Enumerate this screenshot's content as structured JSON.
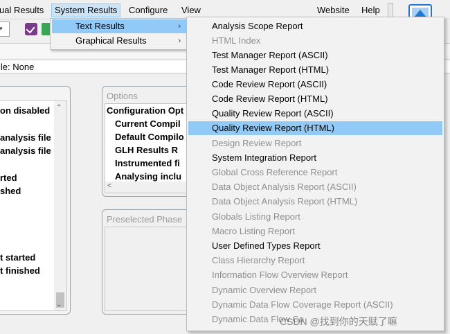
{
  "menubar": {
    "items": [
      "ual Results",
      "System Results",
      "Configure",
      "View",
      "Website",
      "Help"
    ]
  },
  "file_row": {
    "label": "ile: None"
  },
  "left_panel": {
    "rows": [
      "on disabled",
      "analysis file",
      "analysis file",
      "rted",
      "shed",
      "t started",
      "t finished"
    ]
  },
  "options_panel": {
    "title": "Options",
    "rows": [
      "Configuration Opt",
      "Current Compil",
      "Default Compilo",
      "GLH Results R",
      "Instrumented fi",
      "Analysing inclu"
    ]
  },
  "phases_panel": {
    "title": "Preselected Phase"
  },
  "system_menu": {
    "items": [
      {
        "label": "Text Results",
        "has_submenu": true
      },
      {
        "label": "Graphical Results",
        "has_submenu": true
      }
    ]
  },
  "text_results_menu": {
    "items": [
      {
        "label": "Analysis Scope Report",
        "enabled": true
      },
      {
        "label": "HTML Index",
        "enabled": false
      },
      {
        "label": "Test Manager Report (ASCII)",
        "enabled": true
      },
      {
        "label": "Test Manager Report (HTML)",
        "enabled": true
      },
      {
        "label": "Code Review Report (ASCII)",
        "enabled": true
      },
      {
        "label": "Code Review Report (HTML)",
        "enabled": true
      },
      {
        "label": "Quality Review Report (ASCII)",
        "enabled": true
      },
      {
        "label": "Quality Review Report (HTML)",
        "enabled": true,
        "highlighted": true
      },
      {
        "label": "Design Review Report",
        "enabled": false
      },
      {
        "label": "System Integration Report",
        "enabled": true
      },
      {
        "label": "Global Cross Reference Report",
        "enabled": false
      },
      {
        "label": "Data Object Analysis Report (ASCII)",
        "enabled": false
      },
      {
        "label": "Data Object Analysis Report (HTML)",
        "enabled": false
      },
      {
        "label": "Globals Listing Report",
        "enabled": false
      },
      {
        "label": "Macro Listing Report",
        "enabled": false
      },
      {
        "label": "User Defined Types Report",
        "enabled": true
      },
      {
        "label": "Class Hierarchy Report",
        "enabled": false
      },
      {
        "label": "Information Flow Overview Report",
        "enabled": false
      },
      {
        "label": "Dynamic Overview Report",
        "enabled": false
      },
      {
        "label": "Dynamic Data Flow Coverage Report (ASCII)",
        "enabled": false
      },
      {
        "label": "Dynamic Data Flow Co",
        "enabled": false
      }
    ]
  },
  "watermark": "CSDN @找到你的天赋了嘛",
  "colors": {
    "highlight": "#91c9f7",
    "menu_bg": "#f2f2f2",
    "disabled_text": "#8f8f8f",
    "accent": "#1f78d6"
  },
  "icons": [
    "image-icon",
    "check-icon",
    "chevron-right-icon",
    "scroll-up-arrow-icon",
    "scroll-down-arrow-icon",
    "scroll-left-arrow-icon"
  ]
}
